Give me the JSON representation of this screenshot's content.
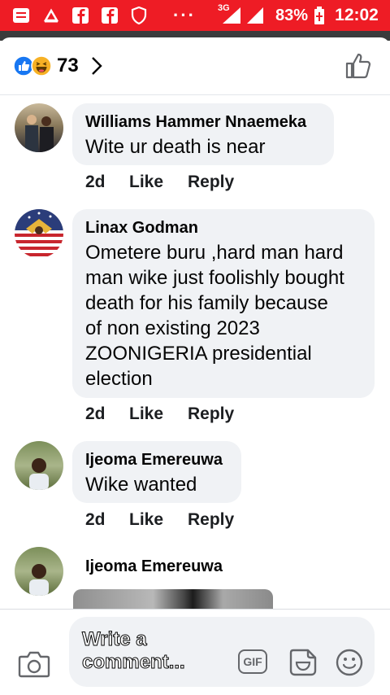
{
  "status_bar": {
    "network": "3G",
    "battery": "83%",
    "time": "12:02",
    "dots": "···"
  },
  "reactions": {
    "count": "73",
    "icons": [
      "like-reaction-icon",
      "haha-reaction-icon"
    ]
  },
  "comments": [
    {
      "author": "Williams Hammer Nnaemeka",
      "text": "Wite ur death is near",
      "time": "2d",
      "like": "Like",
      "reply": "Reply"
    },
    {
      "author": "Linax Godman",
      "text_lines": [
        "Ometere buru ,hard man hard",
        "man wike just foolishly bought",
        "death for his family because",
        "of non existing 2023",
        "ZOONIGERIA presidential",
        "election"
      ],
      "time": "2d",
      "like": "Like",
      "reply": "Reply"
    },
    {
      "author": "Ijeoma Emereuwa",
      "text": "Wike wanted",
      "time": "2d",
      "like": "Like",
      "reply": "Reply"
    },
    {
      "author": "Ijeoma Emereuwa"
    }
  ],
  "composer": {
    "placeholder_lines": [
      "Write a",
      "comment..."
    ],
    "gif_label": "GIF"
  },
  "colors": {
    "status_bar": "#ee1c25",
    "bubble": "#f0f2f5",
    "like_blue": "#1877f2"
  }
}
